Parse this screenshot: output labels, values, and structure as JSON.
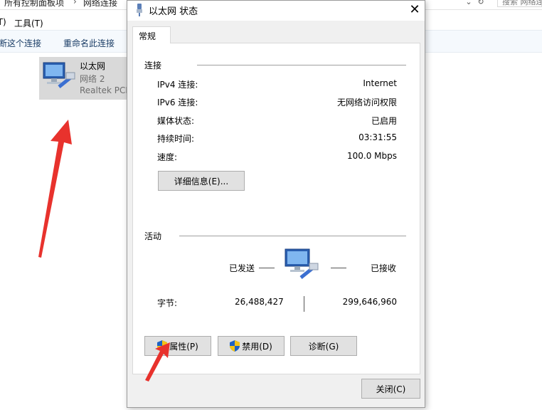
{
  "explorer": {
    "breadcrumb": [
      "所有控制面板项",
      "网络连接"
    ],
    "breadcrumb_sep": "›",
    "search_placeholder": "搜索 网络连接",
    "menu": [
      "(T)",
      "工具(T)"
    ],
    "commands": [
      "断这个连接",
      "重命名此连接"
    ],
    "connection": {
      "name": "以太网",
      "network": "网络 2",
      "device": "Realtek PCIe"
    }
  },
  "dialog": {
    "title": "以太网 状态",
    "close_glyph": "✕",
    "tab": "常规",
    "connection_section": {
      "title": "连接",
      "rows": [
        {
          "label": "IPv4 连接:",
          "value": "Internet"
        },
        {
          "label": "IPv6 连接:",
          "value": "无网络访问权限"
        },
        {
          "label": "媒体状态:",
          "value": "已启用"
        },
        {
          "label": "持续时间:",
          "value": "03:31:55"
        },
        {
          "label": "速度:",
          "value": "100.0 Mbps"
        }
      ],
      "details_button": "详细信息(E)..."
    },
    "activity_section": {
      "title": "活动",
      "sent_label": "已发送",
      "received_label": "已接收",
      "bytes_label": "字节:",
      "bytes_sent": "26,488,427",
      "bytes_received": "299,646,960"
    },
    "buttons": {
      "properties": "属性(P)",
      "disable": "禁用(D)",
      "diagnose": "诊断(G)",
      "close": "关闭(C)"
    }
  },
  "colors": {
    "annotation_arrow": "#e8322d",
    "shield_blue": "#1e62c4",
    "shield_yellow": "#f3c316"
  },
  "icons": [
    "network-adapter-icon",
    "network-cable-icon",
    "shield-icon",
    "close-icon"
  ]
}
